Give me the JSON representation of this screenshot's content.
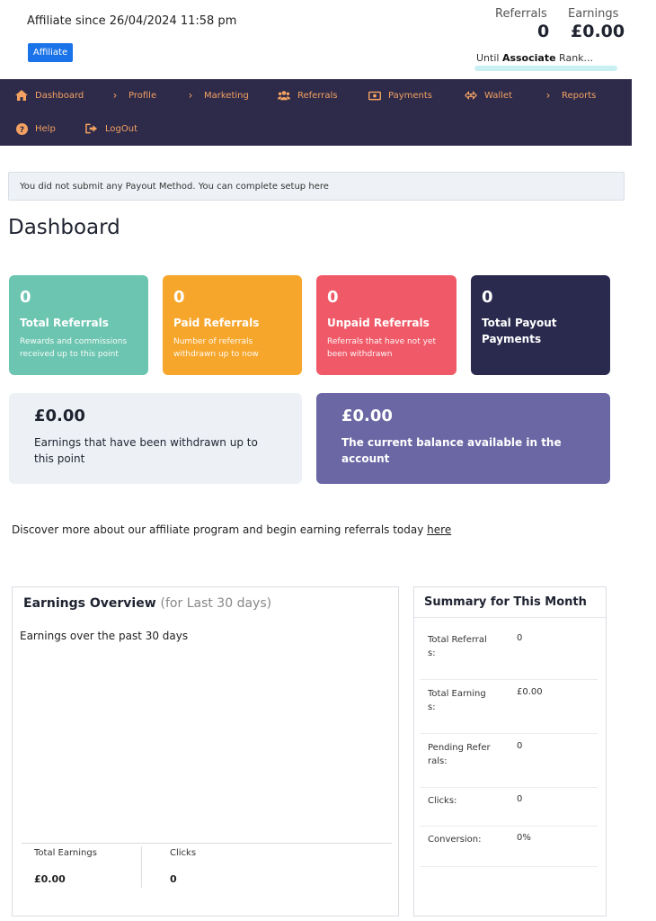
{
  "header": {
    "since_text": "Affiliate since 26/04/2024 11:58 pm",
    "badge": "Affiliate",
    "referrals_label": "Referrals",
    "referrals_value": "0",
    "earnings_label": "Earnings",
    "earnings_value": "£0.00",
    "rank_prefix": "Until ",
    "rank_name": "Associate",
    "rank_suffix": " Rank..."
  },
  "nav": {
    "items": [
      {
        "label": "Dashboard",
        "icon": "home-icon"
      },
      {
        "label": "Profile",
        "icon": "chevron-right-icon"
      },
      {
        "label": "Marketing",
        "icon": "chevron-right-icon"
      },
      {
        "label": "Referrals",
        "icon": "users-icon"
      },
      {
        "label": "Payments",
        "icon": "money-bill-icon"
      },
      {
        "label": "Wallet",
        "icon": "exchange-icon"
      },
      {
        "label": "Reports",
        "icon": "chevron-right-icon"
      },
      {
        "label": "Help",
        "icon": "question-circle-icon"
      },
      {
        "label": "LogOut",
        "icon": "sign-out-icon"
      }
    ]
  },
  "notice": {
    "text": "You did not submit any Payout Method. You can complete setup ",
    "link": "here"
  },
  "page_title": "Dashboard",
  "cards": [
    {
      "value": "0",
      "title": "Total Referrals",
      "desc": "Rewards and commissions received up to this point",
      "color": "#6cc5b0"
    },
    {
      "value": "0",
      "title": "Paid Referrals",
      "desc": "Number of referrals withdrawn up to now",
      "color": "#f7a62c"
    },
    {
      "value": "0",
      "title": "Unpaid Referrals",
      "desc": "Referrals that have not yet been withdrawn",
      "color": "#f05a68"
    },
    {
      "value": "0",
      "title": "Total Payout Payments",
      "desc": "",
      "color": "#2a2a4f"
    }
  ],
  "wide_cards": [
    {
      "value": "£0.00",
      "desc": "Earnings that have been withdrawn up to this point",
      "color": "#edf1f6"
    },
    {
      "value": "£0.00",
      "desc": "The current balance available in the account",
      "color": "#6a67a4"
    }
  ],
  "discover": {
    "text": "Discover more about our affiliate program and begin earning referrals today ",
    "link": "here"
  },
  "earnings_overview": {
    "title": "Earnings Overview",
    "subtitle": "(for Last 30 days)",
    "caption": "Earnings over the past 30 days",
    "total_earnings_label": "Total Earnings",
    "total_earnings_value": "£0.00",
    "clicks_label": "Clicks",
    "clicks_value": "0"
  },
  "summary": {
    "title": "Summary for This Month",
    "rows": [
      {
        "label": "Total Referrals:",
        "value": "0"
      },
      {
        "label": "Total Earnings:",
        "value": "£0.00"
      },
      {
        "label": "Pending Referrals:",
        "value": "0"
      },
      {
        "label": "Clicks:",
        "value": "0"
      },
      {
        "label": "Conversion:",
        "value": "0%"
      }
    ]
  }
}
